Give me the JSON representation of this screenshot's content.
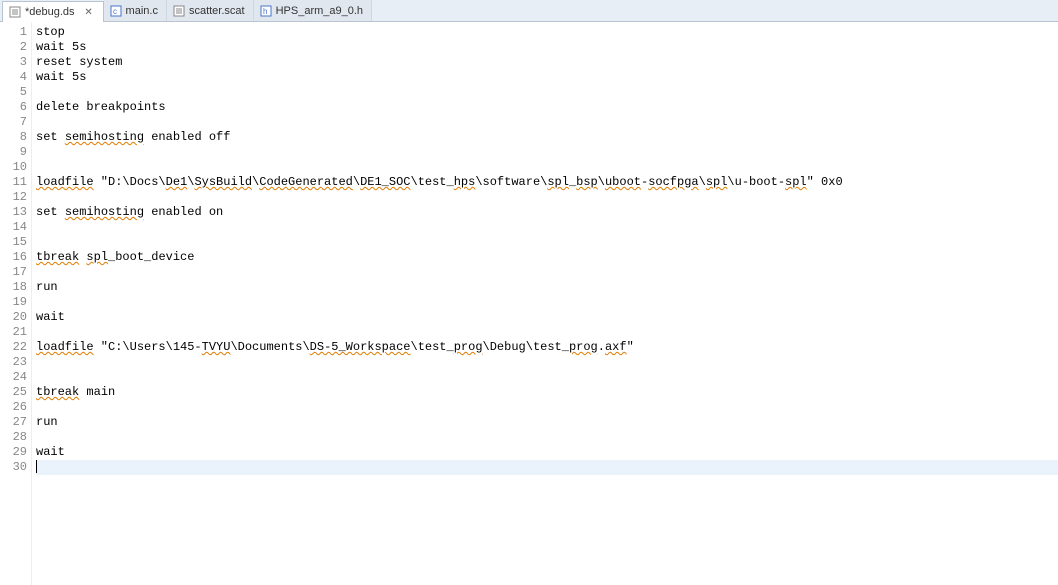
{
  "tabs": [
    {
      "label": "*debug.ds",
      "icon": "file-text-icon",
      "active": true,
      "closeable": true
    },
    {
      "label": "main.c",
      "icon": "c-file-icon",
      "active": false,
      "closeable": false
    },
    {
      "label": "scatter.scat",
      "icon": "file-text-icon",
      "active": false,
      "closeable": false
    },
    {
      "label": "HPS_arm_a9_0.h",
      "icon": "h-file-icon",
      "active": false,
      "closeable": false
    }
  ],
  "close_glyph": "✕",
  "current_line": 30,
  "lines": [
    "stop",
    "wait 5s",
    "reset system",
    "wait 5s",
    "",
    "delete breakpoints",
    "",
    "set semihosting enabled off",
    "",
    "",
    "loadfile \"D:\\Docs\\De1\\SysBuild\\CodeGenerated\\DE1_SOC\\test_hps\\software\\spl_bsp\\uboot-socfpga\\spl\\u-boot-spl\" 0x0",
    "",
    "set semihosting enabled on",
    "",
    "",
    "tbreak spl_boot_device",
    "",
    "run",
    "",
    "wait",
    "",
    "loadfile \"C:\\Users\\145-TVYU\\Documents\\DS-5_Workspace\\test_prog\\Debug\\test_prog.axf\"",
    "",
    "",
    "tbreak main",
    "",
    "run",
    "",
    "wait",
    ""
  ],
  "spellcheck_words": [
    "semihosting",
    "loadfile",
    "De1",
    "SysBuild",
    "CodeGenerated",
    "DE1_SOC",
    "hps",
    "spl",
    "bsp",
    "uboot",
    "socfpga",
    "tbreak",
    "TVYU",
    "DS-5_Workspace",
    "prog",
    "axf"
  ]
}
